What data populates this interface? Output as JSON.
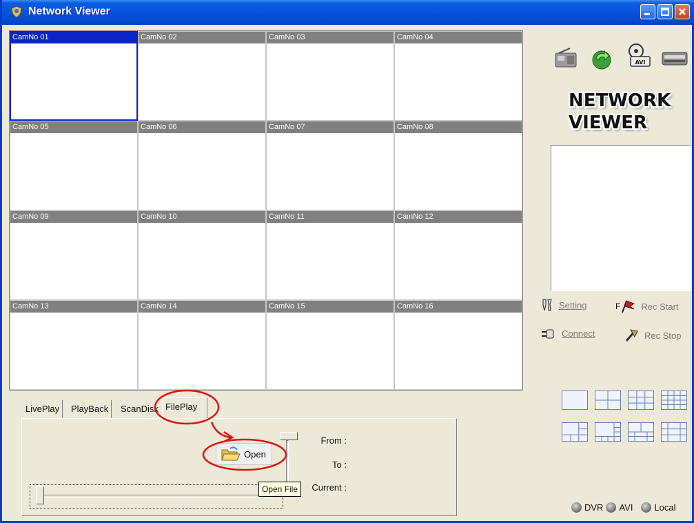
{
  "window": {
    "title": "Network Viewer",
    "icon": "app-shield-icon"
  },
  "cameras": [
    "CamNo 01",
    "CamNo 02",
    "CamNo 03",
    "CamNo 04",
    "CamNo 05",
    "CamNo 06",
    "CamNo 07",
    "CamNo 08",
    "CamNo 09",
    "CamNo 10",
    "CamNo 11",
    "CamNo 12",
    "CamNo 13",
    "CamNo 14",
    "CamNo 15",
    "CamNo 16"
  ],
  "selected_camera": "CamNo 01",
  "right_panel": {
    "logo_line1": "NETWORK",
    "logo_line2": "VIEWER",
    "toolbar_icons": [
      "radio-icon",
      "refresh-arrow-icon",
      "avi-reel-icon",
      "dvr-device-icon"
    ],
    "actions": {
      "setting": "Setting",
      "connect": "Connect",
      "rec_start": "Rec Start",
      "rec_stop": "Rec Stop",
      "rec_start_prefix": "F"
    },
    "layouts": [
      "1x1",
      "2x2",
      "3x3",
      "4x4",
      "1+5",
      "1+7",
      "2+8",
      "custom"
    ],
    "sources": {
      "dvr": "DVR",
      "avi": "AVI",
      "local": "Local"
    }
  },
  "tabs": {
    "live_play": "LivePlay",
    "play_back": "PlayBack",
    "scan_disk": "ScanDisk",
    "file_play": "FilePlay",
    "active": "FilePlay"
  },
  "file_play": {
    "open_label": "Open",
    "open_tooltip": "Open File",
    "from_label": "From :",
    "to_label": "To :",
    "current_label": "Current :"
  },
  "colors": {
    "titlebar": "#0553df",
    "selected": "#0a24c8",
    "cell_header": "#808080",
    "annotation": "#e01010"
  }
}
